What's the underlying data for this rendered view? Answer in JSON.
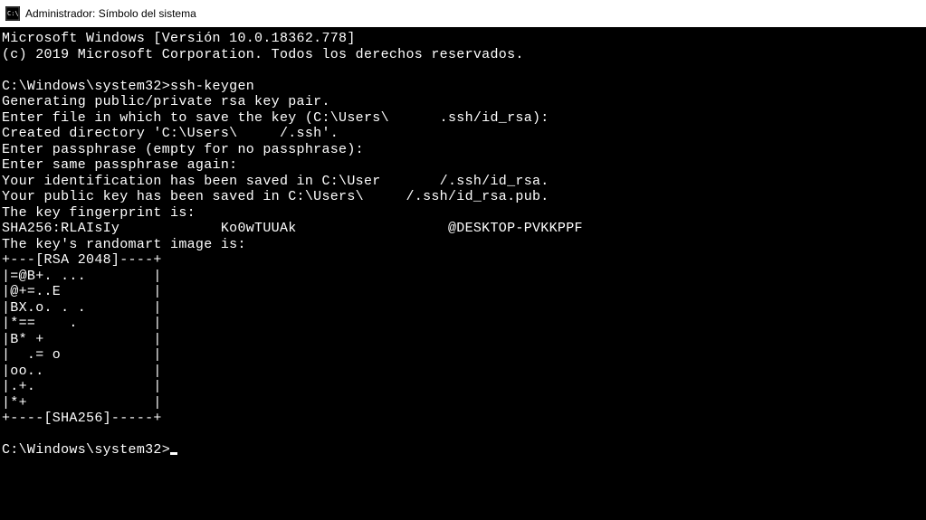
{
  "window": {
    "title": "Administrador: Símbolo del sistema"
  },
  "terminal": {
    "lines": [
      "Microsoft Windows [Versión 10.0.18362.778]",
      "(c) 2019 Microsoft Corporation. Todos los derechos reservados.",
      "",
      "C:\\Windows\\system32>ssh-keygen",
      "Generating public/private rsa key pair.",
      "Enter file in which to save the key (C:\\Users\\      .ssh/id_rsa):",
      "Created directory 'C:\\Users\\     /.ssh'.",
      "Enter passphrase (empty for no passphrase):",
      "Enter same passphrase again:",
      "Your identification has been saved in C:\\User       /.ssh/id_rsa.",
      "Your public key has been saved in C:\\Users\\     /.ssh/id_rsa.pub.",
      "The key fingerprint is:",
      "SHA256:RLAIsIy            Ko0wTUUAk                  @DESKTOP-PVKKPPF",
      "The key's randomart image is:",
      "+---[RSA 2048]----+",
      "|=@B+. ...        |",
      "|@+=..E           |",
      "|BX.o. . .        |",
      "|*==    .         |",
      "|B* +             |",
      "|  .= o           |",
      "|oo..             |",
      "|.+.              |",
      "|*+               |",
      "+----[SHA256]-----+",
      "",
      "C:\\Windows\\system32>"
    ]
  }
}
